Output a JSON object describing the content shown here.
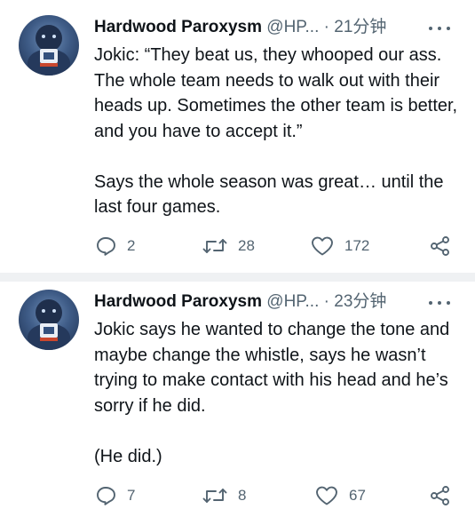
{
  "tweets": [
    {
      "author_name": "Hardwood Paroxysm",
      "handle": "@HP...",
      "separator": "·",
      "time": "21分钟",
      "paragraphs": [
        "Jokic: “They beat us, they whooped our ass. The whole team needs to walk out with their heads up. Sometimes the other team is better, and you have to accept it.”",
        "Says the whole season was great… until the last four games."
      ],
      "replies": "2",
      "retweets": "28",
      "likes": "172"
    },
    {
      "author_name": "Hardwood Paroxysm",
      "handle": "@HP...",
      "separator": "·",
      "time": "23分钟",
      "paragraphs": [
        "Jokic says he wanted to change the tone and maybe change the whistle, says he wasn’t trying to make contact with his head and he’s sorry if he did.",
        "(He did.)"
      ],
      "replies": "7",
      "retweets": "8",
      "likes": "67"
    }
  ],
  "colors": {
    "text": "#0f1419",
    "secondary": "#536471",
    "divider": "#eff1f3"
  },
  "icons": [
    "reply-icon",
    "retweet-icon",
    "like-icon",
    "share-icon",
    "more-icon"
  ]
}
